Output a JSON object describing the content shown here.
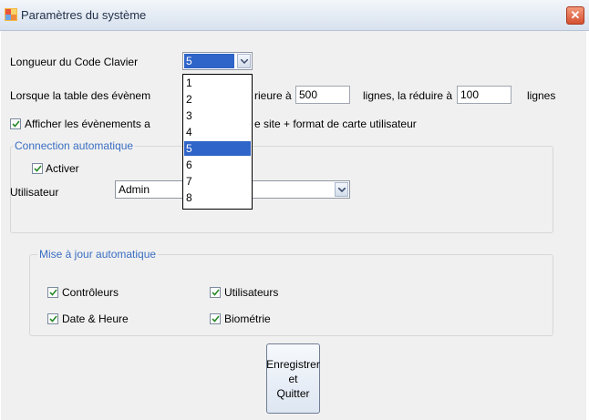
{
  "window": {
    "title": "Paramètres du système",
    "close_symbol": "✕"
  },
  "keyboard_code": {
    "label": "Longueur du Code Clavier",
    "selected": "5",
    "options": [
      "1",
      "2",
      "3",
      "4",
      "5",
      "6",
      "7",
      "8"
    ]
  },
  "event_table": {
    "prefix": "Lorsque la table des évènem",
    "middle": "rieure à",
    "max_value": "500",
    "reduce_label": "lignes, la réduire à",
    "reduce_value": "100",
    "suffix": "lignes"
  },
  "show_events": {
    "label_left": "Afficher les évènements a",
    "label_right": "e site + format de carte utilisateur",
    "checked": true
  },
  "auto_connect": {
    "title": "Connection automatique",
    "enable_label": "Activer",
    "enable_checked": true,
    "user_label": "Utilisateur",
    "user_value": "Admin"
  },
  "auto_update": {
    "title": "Mise à jour automatique",
    "items": [
      {
        "label": "Contrôleurs",
        "checked": true
      },
      {
        "label": "Utilisateurs",
        "checked": true
      },
      {
        "label": "Date & Heure",
        "checked": true
      },
      {
        "label": "Biométrie",
        "checked": true
      }
    ]
  },
  "save_button": {
    "line1": "Enregistrer et",
    "line2": "Quitter"
  },
  "colors": {
    "accent": "#3a6ec2",
    "selection": "#2f64c8",
    "close": "#d4502f"
  }
}
